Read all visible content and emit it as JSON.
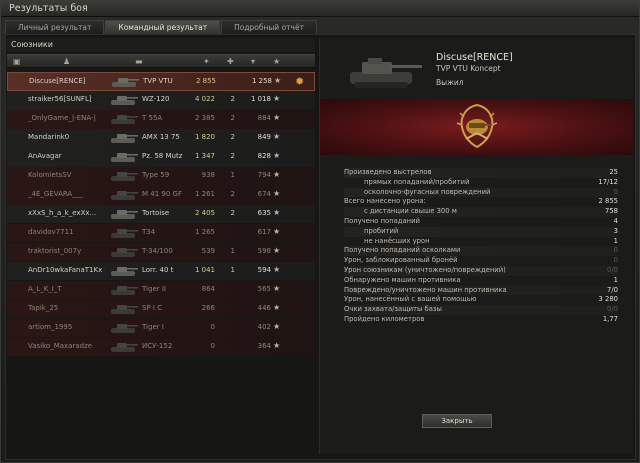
{
  "window": {
    "title": "Результаты боя"
  },
  "tabs": [
    {
      "label": "Личный результат",
      "active": false
    },
    {
      "label": "Командный результат",
      "active": true
    },
    {
      "label": "Подробный отчёт",
      "active": false
    }
  ],
  "team": {
    "title": "Союзники",
    "columns": [
      "squad-icon",
      "player-icon",
      "tank-icon",
      "damage-icon",
      "kills-icon",
      "xp-icon",
      "star-icon"
    ],
    "players": [
      {
        "name": "Discuse[RENCE]",
        "tank": "TVP VTU",
        "damage": "2 855",
        "kills": "",
        "xp": "1 258",
        "dead": false,
        "selected": true,
        "medal": true
      },
      {
        "name": "straiker56[SUNFL]",
        "tank": "WZ-120",
        "damage": "4 022",
        "kills": "2",
        "xp": "1 018",
        "dead": false,
        "selected": false,
        "medal": false
      },
      {
        "name": "_OnlyGame_|-ENA-|",
        "tank": "T 55A",
        "damage": "2 385",
        "kills": "2",
        "xp": "884",
        "dead": true,
        "selected": false,
        "medal": false
      },
      {
        "name": "Mandarink0",
        "tank": "AMX 13 75",
        "damage": "1 820",
        "kills": "2",
        "xp": "849",
        "dead": false,
        "selected": false,
        "medal": false
      },
      {
        "name": "AnAvagar",
        "tank": "Pz. 58 Mutz",
        "damage": "1 347",
        "kills": "2",
        "xp": "828",
        "dead": false,
        "selected": false,
        "medal": false
      },
      {
        "name": "KolomietsSV",
        "tank": "Type 59",
        "damage": "938",
        "kills": "1",
        "xp": "794",
        "dead": true,
        "selected": false,
        "medal": false
      },
      {
        "name": "_4E_GEVARA___",
        "tank": "M 41 90 GF",
        "damage": "1 261",
        "kills": "2",
        "xp": "674",
        "dead": true,
        "selected": false,
        "medal": false
      },
      {
        "name": "xXxS_h_a_k_exXx...",
        "tank": "Tortoise",
        "damage": "2 405",
        "kills": "2",
        "xp": "635",
        "dead": false,
        "selected": false,
        "medal": false
      },
      {
        "name": "davidov7711",
        "tank": "T34",
        "damage": "1 265",
        "kills": "",
        "xp": "617",
        "dead": true,
        "selected": false,
        "medal": false
      },
      {
        "name": "traktorist_007y",
        "tank": "T-34/100",
        "damage": "539",
        "kills": "1",
        "xp": "598",
        "dead": true,
        "selected": false,
        "medal": false
      },
      {
        "name": "AnDr10wkaFanaT1Kx...",
        "tank": "Lorr. 40 t",
        "damage": "1 041",
        "kills": "1",
        "xp": "594",
        "dead": false,
        "selected": false,
        "medal": false
      },
      {
        "name": "A_L_K_I_T",
        "tank": "Tiger II",
        "damage": "864",
        "kills": "",
        "xp": "565",
        "dead": true,
        "selected": false,
        "medal": false
      },
      {
        "name": "Tapik_25",
        "tank": "SP I C",
        "damage": "266",
        "kills": "",
        "xp": "446",
        "dead": true,
        "selected": false,
        "medal": false
      },
      {
        "name": "artiom_1995",
        "tank": "Tiger I",
        "damage": "0",
        "kills": "",
        "xp": "402",
        "dead": true,
        "selected": false,
        "medal": false
      },
      {
        "name": "Vasiko_Maxaradze",
        "tank": "ИСУ-152",
        "damage": "0",
        "kills": "",
        "xp": "364",
        "dead": true,
        "selected": false,
        "medal": false
      }
    ]
  },
  "detail": {
    "player_name": "Discuse[RENCE]",
    "vehicle_name": "TVP VTU Koncept",
    "status": "Выжил",
    "stats": [
      {
        "label": "Произведено выстрелов",
        "value": "25",
        "sub": false,
        "dim": false
      },
      {
        "label": "прямых попаданий/пробитий",
        "value": "17/12",
        "sub": true,
        "dim": false
      },
      {
        "label": "осколочно-фугасных повреждений",
        "value": "0",
        "sub": true,
        "dim": true
      },
      {
        "label": "Всего нанесено урона:",
        "value": "2 855",
        "sub": false,
        "dim": false
      },
      {
        "label": "с дистанции свыше 300 м",
        "value": "758",
        "sub": true,
        "dim": false
      },
      {
        "label": "Получено попаданий",
        "value": "4",
        "sub": false,
        "dim": false
      },
      {
        "label": "пробитий",
        "value": "3",
        "sub": true,
        "dim": false
      },
      {
        "label": "не нанёсших урон",
        "value": "1",
        "sub": true,
        "dim": false
      },
      {
        "label": "Получено попаданий осколками",
        "value": "0",
        "sub": false,
        "dim": true
      },
      {
        "label": "Урон, заблокированный бронёй",
        "value": "0",
        "sub": false,
        "dim": true
      },
      {
        "label": "Урон союзникам (уничтожено/повреждений)",
        "value": "0/0",
        "sub": false,
        "dim": true
      },
      {
        "label": "Обнаружено машин противника",
        "value": "1",
        "sub": false,
        "dim": false
      },
      {
        "label": "Повреждено/уничтожено машин противника",
        "value": "7/0",
        "sub": false,
        "dim": false
      },
      {
        "label": "Урон, нанесённый с вашей помощью",
        "value": "3 280",
        "sub": false,
        "dim": false
      },
      {
        "label": "Очки захвата/защиты базы",
        "value": "0/0",
        "sub": false,
        "dim": true
      },
      {
        "label": "Пройдено километров",
        "value": "1,77",
        "sub": false,
        "dim": false
      }
    ]
  },
  "close_label": "Закрыть"
}
